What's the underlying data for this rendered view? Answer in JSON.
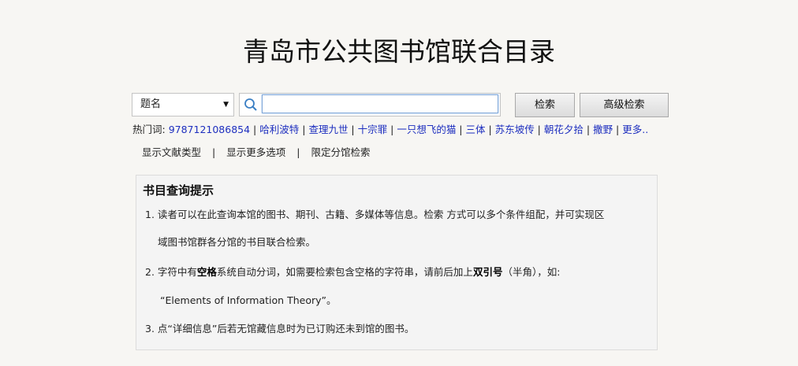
{
  "title": "青岛市公共图书馆联合目录",
  "search": {
    "field_selected": "题名",
    "input_value": "",
    "search_button": "检索",
    "advanced_button": "高级检索"
  },
  "hot_words": {
    "label": "热门词: ",
    "items": [
      "9787121086854",
      "哈利波特",
      "查理九世",
      "十宗罪",
      "一只想飞的猫",
      "三体",
      "苏东坡传",
      "朝花夕拾",
      "撒野"
    ],
    "more": "更多.."
  },
  "options": [
    "显示文献类型",
    "显示更多选项",
    "限定分馆检索"
  ],
  "tips": {
    "title": "书目查询提示",
    "item1_line1": "1. 读者可以在此查询本馆的图书、期刊、古籍、多媒体等信息。检索 方式可以多个条件组配，并可实现区",
    "item1_line2": "域图书馆群各分馆的书目联合检索。",
    "item2_pre": "2. 字符中有",
    "item2_bold1": "空格",
    "item2_mid": "系统自动分词，如需要检索包含空格的字符串，请前后加上",
    "item2_bold2": "双引号",
    "item2_post": "（半角），如:",
    "item2_line2": "“Elements of Information Theory”。",
    "item3": "3. 点“详细信息”后若无馆藏信息时为已订购还未到馆的图书。"
  },
  "colors": {
    "link": "#1e2fbf",
    "background": "#f7f6f3"
  }
}
